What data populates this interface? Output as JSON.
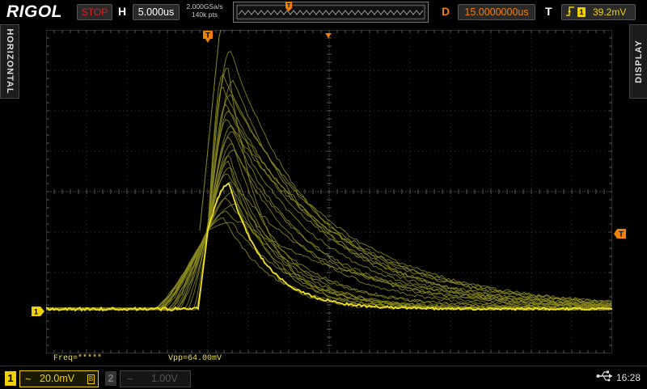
{
  "header": {
    "logo": "RIGOL",
    "run_status": "STOP",
    "horizontal_label": "H",
    "timebase": "5.000us",
    "sample_rate": "2.000GSa/s",
    "memory_depth": "140k pts",
    "delay_label": "D",
    "delay": "15.0000000us",
    "trigger_label": "T",
    "trigger_edge_icon": "rising-edge-icon",
    "trigger_source": "1",
    "trigger_level": "39.2mV"
  },
  "side_tabs": {
    "left": "HORIZONTAL",
    "right": "DISPLAY"
  },
  "markers": {
    "channel1": "1",
    "trigger_position": "T",
    "trigger_level": "T"
  },
  "measurements": {
    "freq": "Freq=*****",
    "vpp": "Vpp=64.00mV"
  },
  "footer": {
    "ch1_number": "1",
    "ch1_coupling_icon": "~",
    "ch1_scale": "20.0mV",
    "ch1_bw_icon": "B",
    "ch2_number": "2",
    "ch2_coupling_icon": "~",
    "ch2_scale": "1.00V",
    "usb_icon": "usb-icon",
    "time": "16:28"
  },
  "colors": {
    "ch1": "#f0d000",
    "ch1_persist": "#8a8a20",
    "trigger": "#f08000",
    "stop": "#e02020"
  }
}
